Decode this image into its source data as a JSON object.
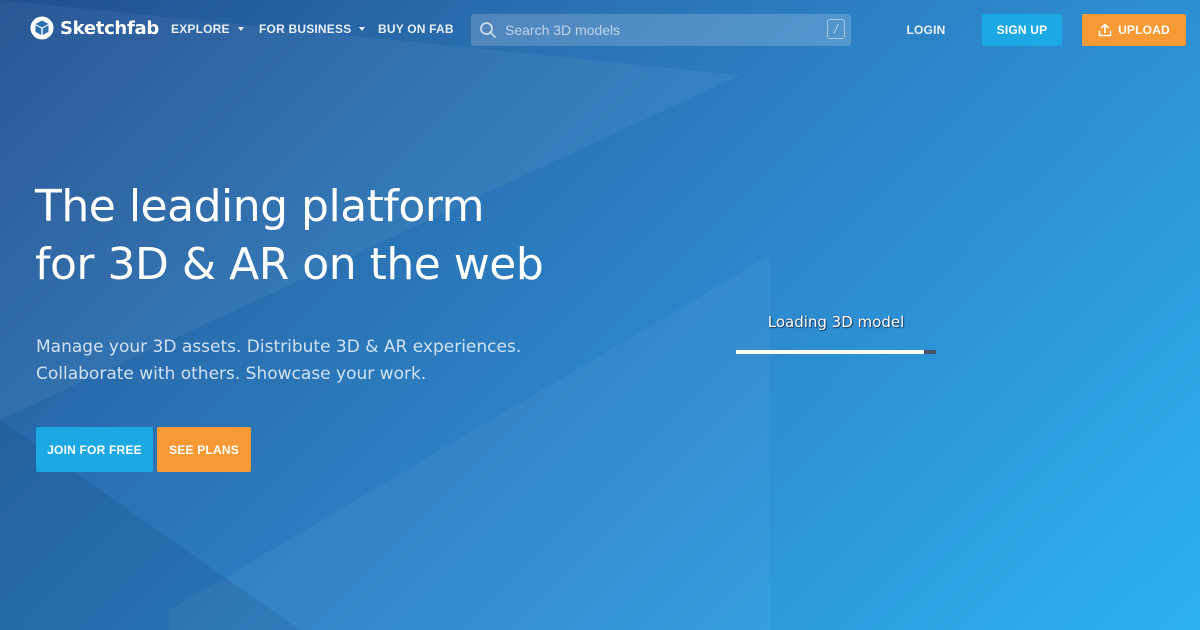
{
  "brand": {
    "name": "Sketchfab",
    "logo_icon": "sketchfab-cube-logo"
  },
  "nav": {
    "explore": "EXPLORE",
    "for_business": "FOR BUSINESS",
    "buy_on_fab": "BUY ON FAB"
  },
  "search": {
    "placeholder": "Search 3D models",
    "shortcut_key": "/",
    "icon": "search-icon"
  },
  "auth": {
    "login": "LOGIN",
    "signup": "SIGN UP",
    "upload": "UPLOAD",
    "upload_icon": "upload-icon"
  },
  "hero": {
    "title_line1": "The leading platform",
    "title_line2": "for 3D & AR on the web",
    "subtitle_line1": "Manage your 3D assets. Distribute 3D & AR experiences.",
    "subtitle_line2": "Collaborate with others. Showcase your work.",
    "join_button": "JOIN FOR FREE",
    "plans_button": "SEE PLANS"
  },
  "loader": {
    "text": "Loading 3D model",
    "progress": 0.94
  },
  "colors": {
    "accent_blue": "#1ca8e2",
    "accent_orange": "#f79a35",
    "bg_dark": "#1f4f8f",
    "bg_light": "#2cb3ee"
  }
}
